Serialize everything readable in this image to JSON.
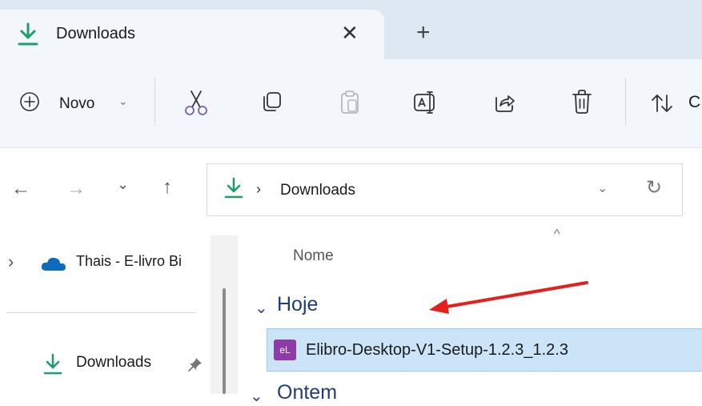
{
  "tab": {
    "title": "Downloads",
    "close": "✕",
    "new_tab": "+"
  },
  "toolbar": {
    "new_label": "Novo",
    "new_caret": "⌄",
    "sort_partial": "C"
  },
  "nav": {
    "back": "←",
    "forward": "→",
    "recent": "⌄",
    "up": "↑"
  },
  "address": {
    "separator": "›",
    "path": "Downloads",
    "caret": "⌄",
    "refresh": "↻"
  },
  "sidebar": {
    "chevron": "›",
    "onedrive_label": "Thais - E-livro Bi",
    "downloads_label": "Downloads",
    "pin": "📌"
  },
  "content": {
    "sort_indicator": "^",
    "column_name": "Nome",
    "group_chevron": "⌄",
    "group_today": "Hoje",
    "file_name": "Elibro-Desktop-V1-Setup-1.2.3_1.2.3",
    "file_icon_text": "eL",
    "next_group_partial": "Ontem"
  },
  "colors": {
    "accent_green": "#1e9e6a",
    "selection_bg": "#cce4f7",
    "selection_border": "#99c9ef",
    "annotation_arrow": "#e3201b",
    "file_icon_bg": "#8e3aa8"
  },
  "icons": {
    "tab": "download-icon",
    "new": "plus-circle-icon",
    "cut": "scissors-icon",
    "copy": "copy-icon",
    "paste": "clipboard-icon",
    "rename": "rename-icon",
    "share": "share-icon",
    "delete": "trash-icon",
    "sort": "sort-icon",
    "address": "download-icon",
    "onedrive": "cloud-icon",
    "sidebar_downloads": "download-icon"
  }
}
